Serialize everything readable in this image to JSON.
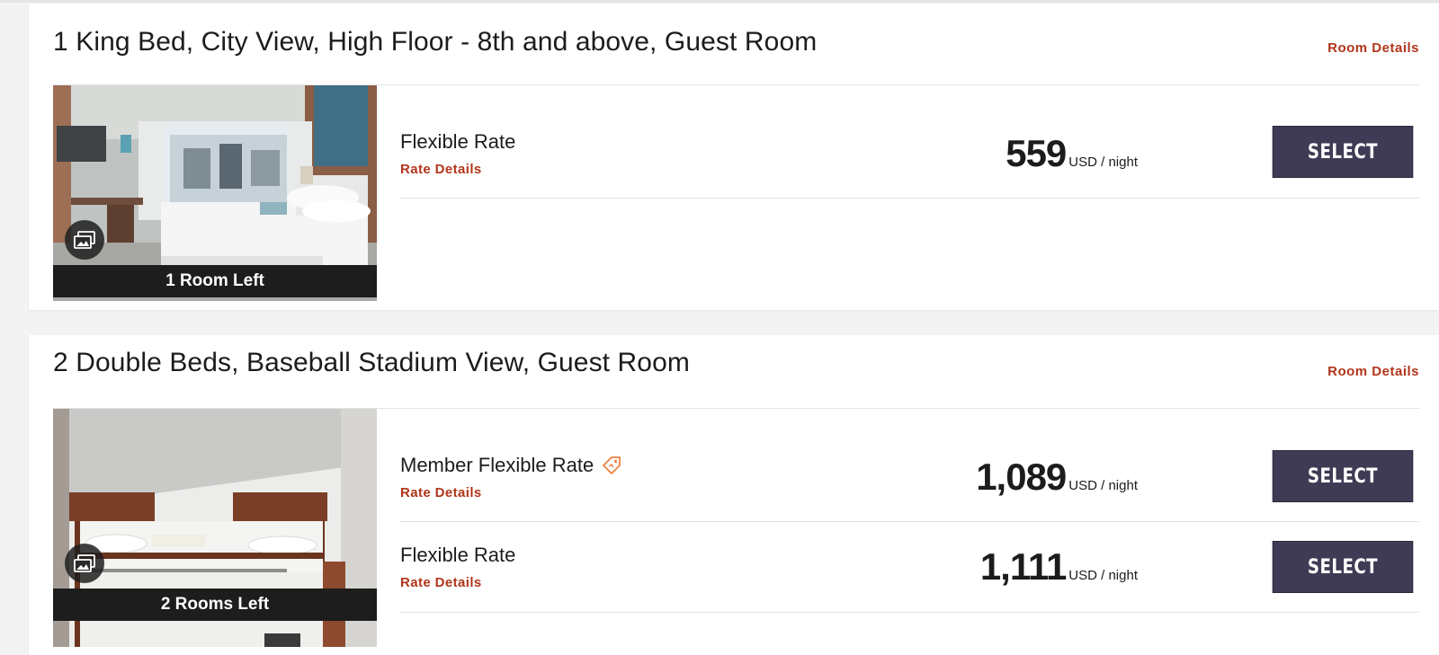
{
  "rooms": [
    {
      "title": "1 King Bed, City View, High Floor - 8th and above, Guest Room",
      "details_link": "Room Details",
      "availability": "1 Room Left",
      "rates": [
        {
          "name": "Flexible Rate",
          "details_link": "Rate Details",
          "price": "559",
          "unit": "USD / night",
          "button": "SELECT"
        }
      ]
    },
    {
      "title": "2 Double Beds, Baseball Stadium View, Guest Room",
      "details_link": "Room Details",
      "availability": "2 Rooms Left",
      "rates": [
        {
          "name": "Member Flexible Rate",
          "details_link": "Rate Details",
          "price": "1,089",
          "unit": "USD / night",
          "button": "SELECT",
          "icon": "member-tag-icon"
        },
        {
          "name": "Flexible Rate",
          "details_link": "Rate Details",
          "price": "1,111",
          "unit": "USD / night",
          "button": "SELECT"
        }
      ]
    }
  ],
  "colors": {
    "link": "#b1351b",
    "button": "#3f3b54",
    "banner": "#1d1d1d",
    "member_icon": "#f0803c"
  }
}
